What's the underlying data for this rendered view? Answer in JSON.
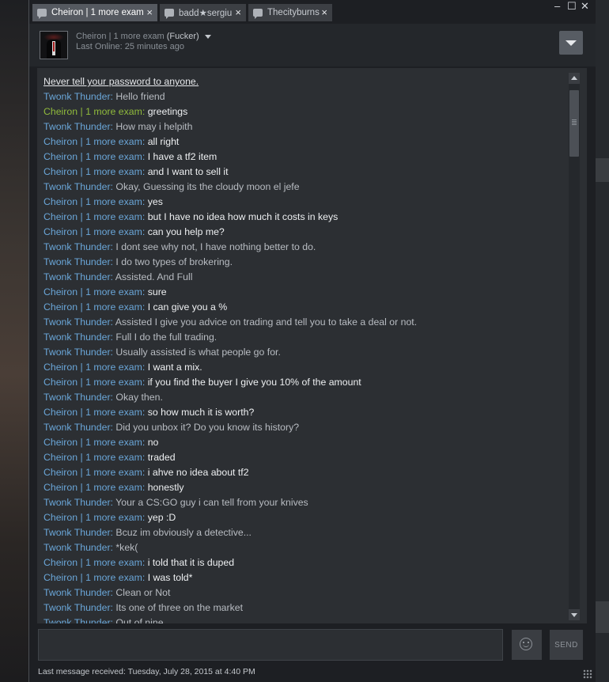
{
  "tabs": [
    {
      "label": "Cheiron | 1 more exam",
      "active": true
    },
    {
      "label": "badd★sergiu",
      "active": false
    },
    {
      "label": "Thecityburns",
      "active": false
    }
  ],
  "window_controls": {
    "minimize": "–",
    "maximize": "☐",
    "close": "✕"
  },
  "header": {
    "name": "Cheiron | 1 more exam",
    "nickname": "(Fucker)",
    "status": "Last Online: 25 minutes ago"
  },
  "chat": {
    "warning": "Never tell your password to anyone.",
    "messages": [
      {
        "speaker": "Twonk Thunder",
        "text": "Hello friend",
        "from": "twonk"
      },
      {
        "speaker": "Cheiron | 1 more exam",
        "text": "greetings",
        "from": "cheiron",
        "highlight": true
      },
      {
        "speaker": "Twonk Thunder",
        "text": "How may i helpith",
        "from": "twonk"
      },
      {
        "speaker": "Cheiron | 1 more exam",
        "text": "all right",
        "from": "cheiron"
      },
      {
        "speaker": "Cheiron | 1 more exam",
        "text": "I have a tf2 item",
        "from": "cheiron"
      },
      {
        "speaker": "Cheiron | 1 more exam",
        "text": "and I want to sell it",
        "from": "cheiron"
      },
      {
        "speaker": "Twonk Thunder",
        "text": "Okay, Guessing its the cloudy moon el jefe",
        "from": "twonk"
      },
      {
        "speaker": "Cheiron | 1 more exam",
        "text": "yes",
        "from": "cheiron"
      },
      {
        "speaker": "Cheiron | 1 more exam",
        "text": "but I have no idea how much it costs in keys",
        "from": "cheiron"
      },
      {
        "speaker": "Cheiron | 1 more exam",
        "text": "can you help me?",
        "from": "cheiron"
      },
      {
        "speaker": "Twonk Thunder",
        "text": "I dont see why not, I have nothing better to do.",
        "from": "twonk"
      },
      {
        "speaker": "Twonk Thunder",
        "text": "I do two types of brokering.",
        "from": "twonk"
      },
      {
        "speaker": "Twonk Thunder",
        "text": "Assisted. And Full",
        "from": "twonk"
      },
      {
        "speaker": "Cheiron | 1 more exam",
        "text": "sure",
        "from": "cheiron"
      },
      {
        "speaker": "Cheiron | 1 more exam",
        "text": "I can give you a %",
        "from": "cheiron"
      },
      {
        "speaker": "Twonk Thunder",
        "text": "Assisted I give you advice on trading and tell you to take a deal or not.",
        "from": "twonk"
      },
      {
        "speaker": "Twonk Thunder",
        "text": "Full I do the full trading.",
        "from": "twonk"
      },
      {
        "speaker": "Twonk Thunder",
        "text": "Usually assisted is what people go for.",
        "from": "twonk"
      },
      {
        "speaker": "Cheiron | 1 more exam",
        "text": "I want a mix.",
        "from": "cheiron"
      },
      {
        "speaker": "Cheiron | 1 more exam",
        "text": "if you find the buyer I give you 10% of the amount",
        "from": "cheiron"
      },
      {
        "speaker": "Twonk Thunder",
        "text": "Okay then.",
        "from": "twonk"
      },
      {
        "speaker": "Cheiron | 1 more exam",
        "text": "so how much it is worth?",
        "from": "cheiron"
      },
      {
        "speaker": "Twonk Thunder",
        "text": "Did you unbox it? Do you know its history?",
        "from": "twonk"
      },
      {
        "speaker": "Cheiron | 1 more exam",
        "text": "no",
        "from": "cheiron"
      },
      {
        "speaker": "Cheiron | 1 more exam",
        "text": "traded",
        "from": "cheiron"
      },
      {
        "speaker": "Cheiron | 1 more exam",
        "text": "i ahve no idea about tf2",
        "from": "cheiron"
      },
      {
        "speaker": "Cheiron | 1 more exam",
        "text": "honestly",
        "from": "cheiron"
      },
      {
        "speaker": "Twonk Thunder",
        "text": "Your a CS:GO guy i can tell from your knives",
        "from": "twonk"
      },
      {
        "speaker": "Cheiron | 1 more exam",
        "text": "yep :D",
        "from": "cheiron"
      },
      {
        "speaker": "Twonk Thunder",
        "text": "Bcuz im obviously a detective...",
        "from": "twonk"
      },
      {
        "speaker": "Twonk Thunder",
        "text": "*kek(",
        "from": "twonk"
      },
      {
        "speaker": "Cheiron | 1 more exam",
        "text": "i told that it is duped",
        "from": "cheiron"
      },
      {
        "speaker": "Cheiron | 1 more exam",
        "text": "I was told*",
        "from": "cheiron"
      },
      {
        "speaker": "Twonk Thunder",
        "text": "Clean or Not",
        "from": "twonk"
      },
      {
        "speaker": "Twonk Thunder",
        "text": "Its one of three on the market",
        "from": "twonk"
      },
      {
        "speaker": "Twonk Thunder",
        "text": "Out of nine",
        "from": "twonk"
      }
    ]
  },
  "input": {
    "value": "",
    "placeholder": ""
  },
  "send_label": "SEND",
  "footer": "Last message received: Tuesday, July 28, 2015 at 4:40 PM",
  "icons": {
    "tab": "chat-bubble-icon",
    "header_menu": "chevron-down-icon",
    "emoji": "smiley-icon",
    "resize": "resize-grip-icon"
  }
}
